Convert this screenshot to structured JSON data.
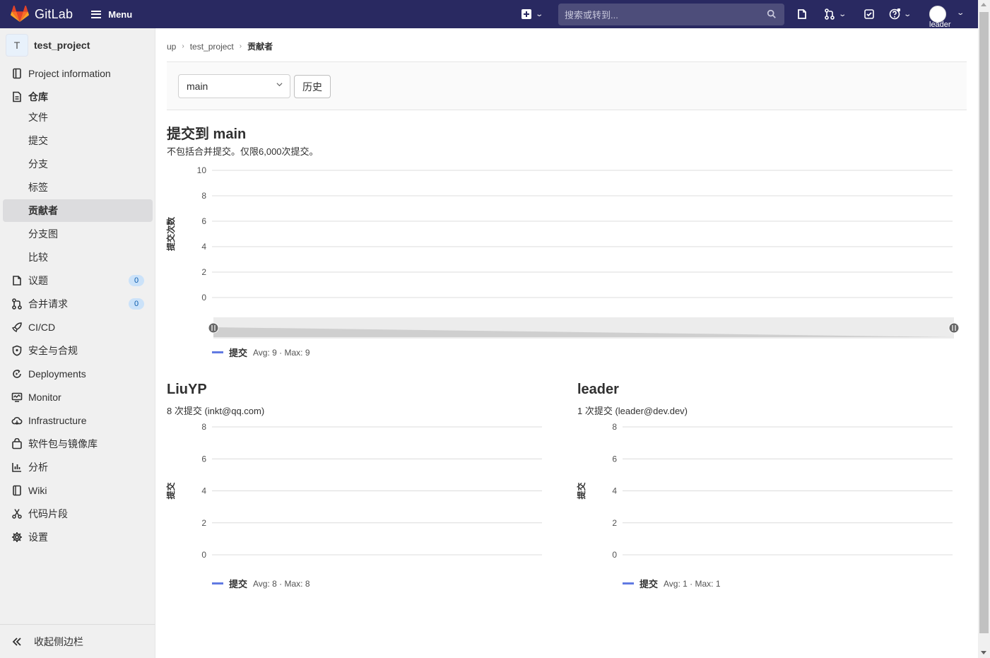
{
  "topbar": {
    "brand": "GitLab",
    "menu_label": "Menu",
    "search_placeholder": "搜索或转到...",
    "user": "leader"
  },
  "sidebar": {
    "project_initial": "T",
    "project_name": "test_project",
    "items": [
      {
        "label": "Project information",
        "icon": "info-icon"
      },
      {
        "label": "仓库",
        "icon": "repository-icon"
      },
      {
        "label": "文件"
      },
      {
        "label": "提交"
      },
      {
        "label": "分支"
      },
      {
        "label": "标签"
      },
      {
        "label": "贡献者"
      },
      {
        "label": "分支图"
      },
      {
        "label": "比较"
      },
      {
        "label": "议题",
        "icon": "issues-icon",
        "count": "0"
      },
      {
        "label": "合并请求",
        "icon": "merge-request-icon",
        "count": "0"
      },
      {
        "label": "CI/CD",
        "icon": "rocket-icon"
      },
      {
        "label": "安全与合规",
        "icon": "shield-icon"
      },
      {
        "label": "Deployments",
        "icon": "deployments-icon"
      },
      {
        "label": "Monitor",
        "icon": "monitor-icon"
      },
      {
        "label": "Infrastructure",
        "icon": "cloud-icon"
      },
      {
        "label": "软件包与镜像库",
        "icon": "package-icon"
      },
      {
        "label": "分析",
        "icon": "chart-icon"
      },
      {
        "label": "Wiki",
        "icon": "book-icon"
      },
      {
        "label": "代码片段",
        "icon": "snippet-icon"
      },
      {
        "label": "设置",
        "icon": "settings-icon"
      }
    ],
    "collapse_label": "收起侧边栏"
  },
  "breadcrumb": [
    "up",
    "test_project",
    "贡献者"
  ],
  "ref": {
    "selected": "main",
    "history_button": "历史"
  },
  "main": {
    "title": "提交到 main",
    "subtitle": "不包括合并提交。仅限6,000次提交。"
  },
  "contributors": [
    {
      "name": "LiuYP",
      "info": "8 次提交 (inkt@qq.com)"
    },
    {
      "name": "leader",
      "info": "1 次提交 (leader@dev.dev)"
    }
  ],
  "colors": {
    "navbar": "#292961",
    "series": "#617ae2",
    "sidebar_bg": "#f0f0f0"
  },
  "chart_data": [
    {
      "type": "area",
      "title": "",
      "ylabel": "提交次数",
      "yticks": [
        10,
        8,
        6,
        4,
        2,
        0
      ],
      "ylim": [
        0,
        10
      ],
      "series": [
        {
          "name": "提交",
          "values": [],
          "stats": "Avg: 9 · Max: 9"
        }
      ],
      "grid": true,
      "legend": "bottom-left"
    },
    {
      "type": "area",
      "title": "",
      "ylabel": "提交",
      "yticks": [
        8,
        6,
        4,
        2,
        0
      ],
      "ylim": [
        0,
        8
      ],
      "series": [
        {
          "name": "提交",
          "values": [],
          "stats": "Avg: 8 · Max: 8"
        }
      ],
      "grid": true,
      "legend": "bottom-left"
    },
    {
      "type": "area",
      "title": "",
      "ylabel": "提交",
      "yticks": [
        8,
        6,
        4,
        2,
        0
      ],
      "ylim": [
        0,
        8
      ],
      "series": [
        {
          "name": "提交",
          "values": [],
          "stats": "Avg: 1 · Max: 1"
        }
      ],
      "grid": true,
      "legend": "bottom-left"
    }
  ]
}
